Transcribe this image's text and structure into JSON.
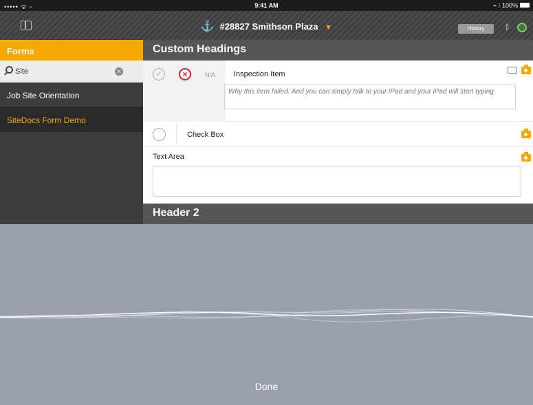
{
  "status_bar": {
    "signal": "••••• ᯤ ◦",
    "time": "9:41 AM",
    "battery": "⌁ ⁝ 100%"
  },
  "nav": {
    "title": "#28827 Smithson Plaza",
    "history_label": "History"
  },
  "sidebar": {
    "header": "Forms",
    "search_value": "Site",
    "items": [
      {
        "label": "Job Site Orientation"
      },
      {
        "label": "SiteDocs Form Demo"
      }
    ]
  },
  "main": {
    "section1_title": "Custom Headings",
    "inspection": {
      "na_label": "N/A",
      "label": "Inspection Item",
      "failure_note": "Why this item failed.  And you can simply talk to your iPad and your iPad will start typing"
    },
    "checkbox_label": "Check Box",
    "textarea_label": "Text Area",
    "section2_title": "Header 2"
  },
  "dictation": {
    "done_label": "Done"
  },
  "colors": {
    "accent": "#f5a800",
    "fail": "#e0202b",
    "dictation_bg": "#98a0ab",
    "sidebar_bg": "#3d3d3d"
  },
  "icons": [
    "sidebar-toggle-icon",
    "anchor-icon",
    "chevron-down-icon",
    "share-icon",
    "gear-icon",
    "search-icon",
    "clear-icon",
    "check-icon",
    "fail-icon",
    "comment-icon",
    "camera-icon"
  ]
}
